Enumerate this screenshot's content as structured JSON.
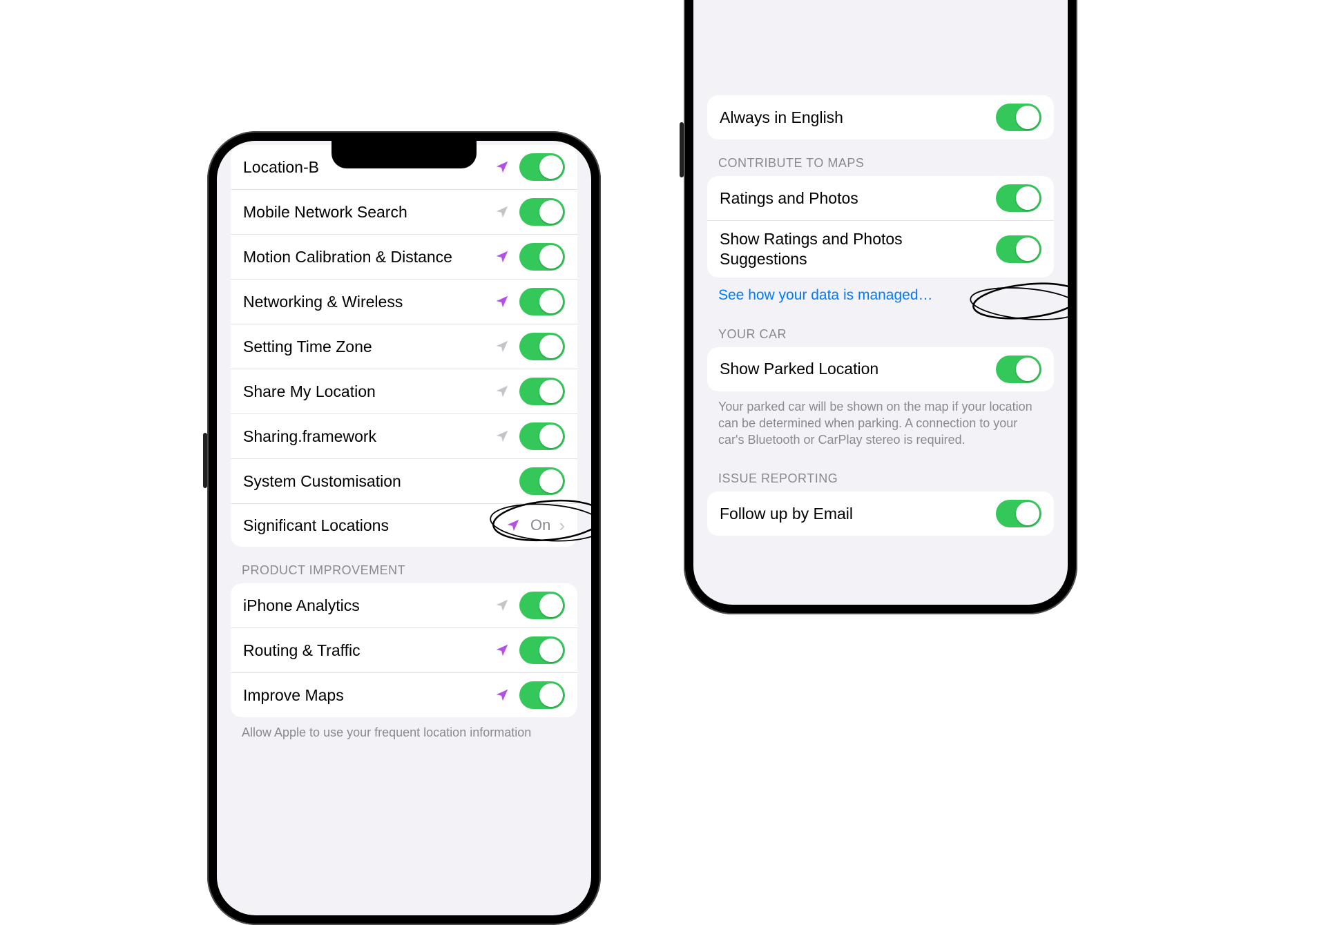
{
  "phones": {
    "left": {
      "section1": {
        "items": [
          {
            "label": "Location-B",
            "arrow": "purple",
            "toggle": true
          },
          {
            "label": "Mobile Network Search",
            "arrow": "gray",
            "toggle": true
          },
          {
            "label": "Motion Calibration & Distance",
            "arrow": "purple",
            "toggle": true
          },
          {
            "label": "Networking & Wireless",
            "arrow": "purple",
            "toggle": true
          },
          {
            "label": "Setting Time Zone",
            "arrow": "gray",
            "toggle": true
          },
          {
            "label": "Share My Location",
            "arrow": "gray",
            "toggle": true
          },
          {
            "label": "Sharing.framework",
            "arrow": "gray",
            "toggle": true
          },
          {
            "label": "System Customisation",
            "arrow": null,
            "toggle": true
          },
          {
            "label": "Significant Locations",
            "arrow": "purple",
            "value": "On",
            "disclosure": true
          }
        ]
      },
      "section2": {
        "header": "PRODUCT IMPROVEMENT",
        "items": [
          {
            "label": "iPhone Analytics",
            "arrow": "gray",
            "toggle": true
          },
          {
            "label": "Routing & Traffic",
            "arrow": "purple",
            "toggle": true
          },
          {
            "label": "Improve Maps",
            "arrow": "purple",
            "toggle": true
          }
        ],
        "footer": "Allow Apple to use your frequent location information"
      }
    },
    "right": {
      "topRow": {
        "label": "Always in English",
        "toggle": true
      },
      "contribute": {
        "header": "CONTRIBUTE TO MAPS",
        "items": [
          {
            "label": "Ratings and Photos",
            "toggle": true
          },
          {
            "label": "Show Ratings and Photos Suggestions",
            "toggle": true
          }
        ],
        "link": "See how your data is managed…"
      },
      "yourCar": {
        "header": "YOUR CAR",
        "items": [
          {
            "label": "Show Parked Location",
            "toggle": true
          }
        ],
        "footer": "Your parked car will be shown on the map if your location can be determined when parking. A connection to your car's Bluetooth or CarPlay stereo is required."
      },
      "issue": {
        "header": "ISSUE REPORTING",
        "items": [
          {
            "label": "Follow up by Email",
            "toggle": true
          }
        ]
      }
    }
  }
}
